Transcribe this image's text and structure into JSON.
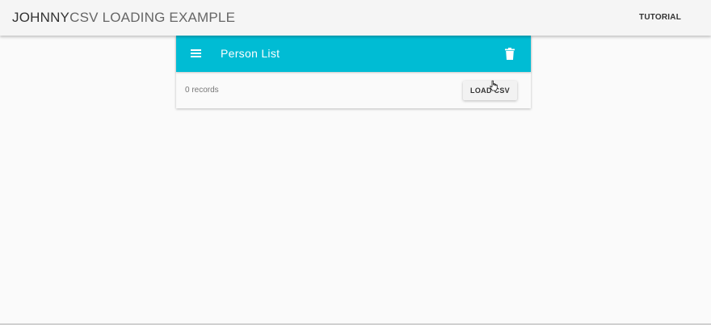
{
  "header": {
    "title_strong": "JOHNNY",
    "title_light": "CSV LOADING EXAMPLE",
    "tutorial_label": "TUTORIAL"
  },
  "card": {
    "title": "Person List",
    "records_text": "0 records",
    "load_button_label": "LOAD CSV",
    "accent_color": "#00bcd4"
  },
  "icons": {
    "menu": "menu-icon",
    "delete": "trash-icon",
    "pointer": "hand-cursor-icon"
  }
}
